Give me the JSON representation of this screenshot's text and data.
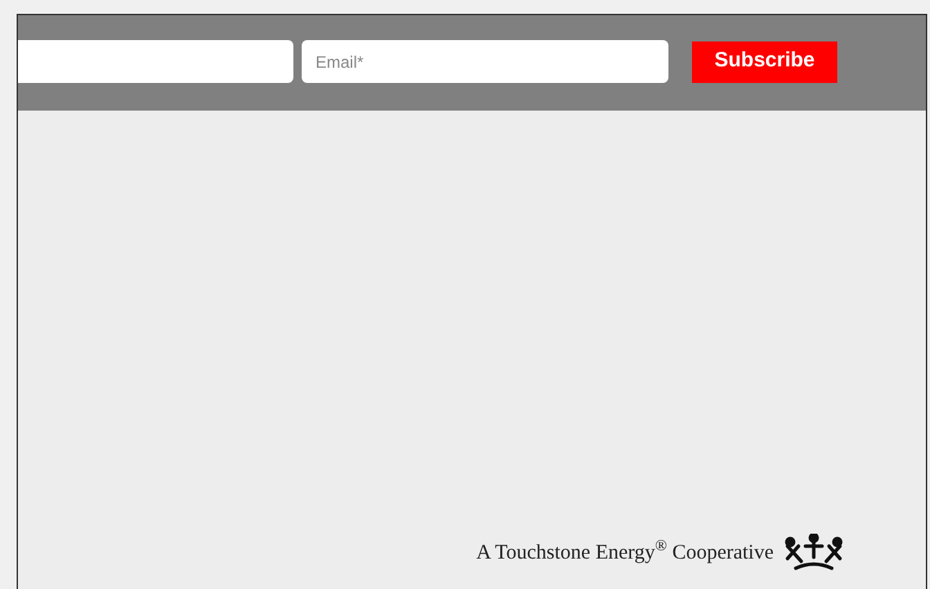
{
  "subscribe_form": {
    "fields": [
      {
        "kind": "blank"
      },
      {
        "kind": "email",
        "placeholder": "Email*"
      }
    ],
    "button": "Subscribe"
  },
  "footer": {
    "tagline": "A Touchstone Energy$^{®}$ Cooperative"
  }
}
